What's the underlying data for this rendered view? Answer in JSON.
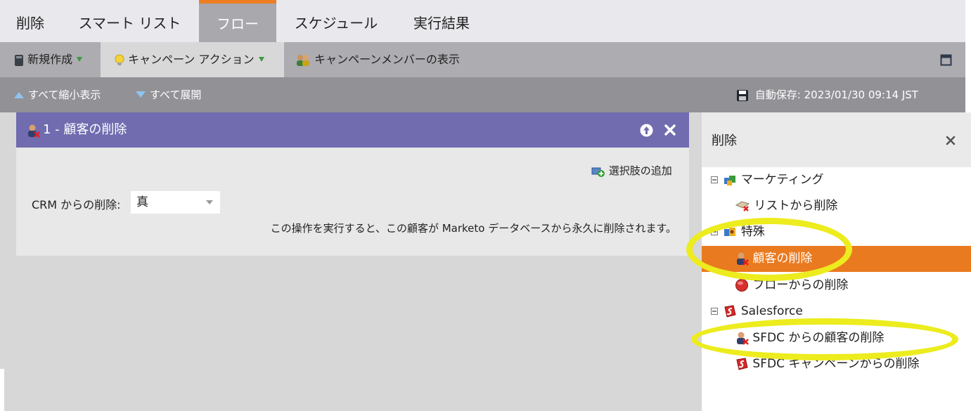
{
  "tabs": [
    {
      "label": "削除"
    },
    {
      "label": "スマート リスト"
    },
    {
      "label": "フロー"
    },
    {
      "label": "スケジュール"
    },
    {
      "label": "実行結果"
    }
  ],
  "toolbar": {
    "new_label": "新規作成",
    "campaign_actions_label": "キャンペーン アクション",
    "view_members_label": "キャンペーンメンバーの表示"
  },
  "subbar": {
    "collapse_all": "すべて縮小表示",
    "expand_all": "すべて展開",
    "autosave": "自動保存: 2023/01/30 09:14 JST"
  },
  "flow_step": {
    "title": "1 - 顧客の削除",
    "add_choice": "選択肢の追加",
    "field_label": "CRM からの削除:",
    "field_value": "真",
    "description": "この操作を実行すると、この顧客が Marketo データベースから永久に削除されます。"
  },
  "panel": {
    "title": "削除",
    "groups": [
      {
        "label": "マーケティング",
        "items": [
          {
            "label": "リストから削除"
          }
        ]
      },
      {
        "label": "特殊",
        "items": [
          {
            "label": "顧客の削除",
            "selected": true
          },
          {
            "label": "フローからの削除"
          }
        ]
      },
      {
        "label": "Salesforce",
        "items": [
          {
            "label": "SFDC からの顧客の削除"
          },
          {
            "label": "SFDC キャンペーンからの削除"
          }
        ]
      }
    ]
  },
  "colors": {
    "accent_orange": "#ee7d22",
    "card_header": "#706caf",
    "highlight_yellow": "#ecec1e"
  }
}
